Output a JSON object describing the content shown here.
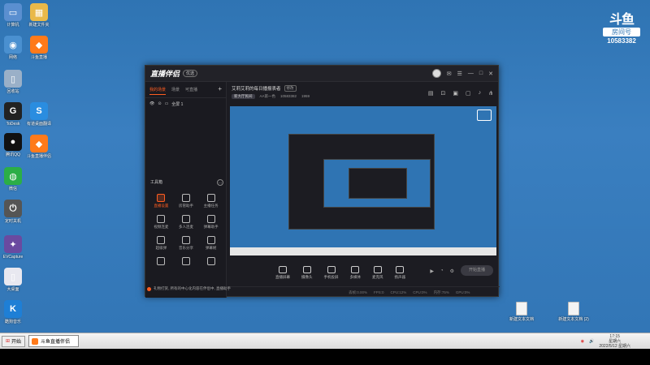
{
  "desktop": {
    "icons_left": [
      {
        "label": "计算机",
        "color": "#5a8fd0",
        "glyph": "▭"
      },
      {
        "label": "网络",
        "color": "#4a90d0",
        "glyph": "◉"
      },
      {
        "label": "回收站",
        "color": "#9ab0c8",
        "glyph": "▯"
      },
      {
        "label": "ToDesk",
        "color": "#222222",
        "glyph": "G"
      },
      {
        "label": "腾讯QQ",
        "color": "#111111",
        "glyph": "●"
      },
      {
        "label": "微信",
        "color": "#2bae47",
        "glyph": "◍"
      },
      {
        "label": "定时关机",
        "color": "#555555",
        "glyph": "⏻"
      },
      {
        "label": "EVCapture",
        "color": "#6a4aa0",
        "glyph": "✦"
      },
      {
        "label": "大桌面",
        "color": "#e8e8f0",
        "glyph": "▯"
      },
      {
        "label": "酷狗音乐",
        "color": "#1e7fd6",
        "glyph": "K"
      }
    ],
    "icons_col2": [
      {
        "label": "新建文件夹",
        "color": "#e9b949",
        "glyph": "▦"
      },
      {
        "label": "斗鱼直播",
        "color": "#ff7a1a",
        "glyph": "◆"
      },
      {
        "label": "有道桌面翻译",
        "color": "#2a8de0",
        "glyph": "S"
      },
      {
        "label": "斗鱼直播伴侣",
        "color": "#ff7a1a",
        "glyph": "◆"
      }
    ],
    "files_right": [
      {
        "label": "新建文本文档"
      },
      {
        "label": "新建文本文档 (2)"
      }
    ],
    "logo": {
      "mark": "斗鱼",
      "room_label": "房间号",
      "room_number": "10583382"
    }
  },
  "app": {
    "title": "直播伴侣",
    "version_badge": "优选",
    "titlebar_icons": [
      "avatar-icon",
      "message-icon",
      "menu-icon",
      "minimize-icon",
      "maximize-icon",
      "close-icon"
    ],
    "sidebar": {
      "tabs": [
        "我的场景",
        "场景",
        "可直播"
      ],
      "plus": "+",
      "scene_label": "全屏 1",
      "tools_title": "工具箱",
      "tools": [
        {
          "label": "直播设置",
          "hot": true
        },
        {
          "label": "房管助手",
          "hot": false
        },
        {
          "label": "主播任务",
          "hot": false
        },
        {
          "label": "视频连麦",
          "hot": false
        },
        {
          "label": "多人连麦",
          "hot": false
        },
        {
          "label": "弹幕助手",
          "hot": false
        },
        {
          "label": "超级弹",
          "hot": false
        },
        {
          "label": "音乐分享",
          "hot": false
        },
        {
          "label": "弹幕姬",
          "hot": false
        },
        {
          "label": "",
          "hot": false
        },
        {
          "label": "",
          "hot": false
        },
        {
          "label": "",
          "hot": false
        }
      ],
      "notice": "礼物打赏, 所有的中心化内容在伴侣中, 直播助手"
    },
    "main": {
      "room_title": "艾莉艾莉的每日播报表者",
      "edit_label": "修改",
      "category": "新大厅民间",
      "room_label": "AA第一色",
      "room_id": "10583382",
      "fans": "1959",
      "bottom_tools": [
        {
          "label": "直播屏幕"
        },
        {
          "label": "摄像头"
        },
        {
          "label": "手机投屏"
        },
        {
          "label": "多媒体"
        },
        {
          "label": "麦克风"
        },
        {
          "label": "扬声器"
        }
      ],
      "go_live": "开始直播",
      "status_items": [
        "丢帧:0.00%",
        "FPS:0",
        "CPU:12%",
        "CPU:0%",
        "内存:75%",
        "GPU:0%"
      ]
    }
  },
  "taskbar": {
    "start": "开始",
    "task_label": "斗鱼直播伴侣",
    "time": "17:15",
    "weekday": "星期六",
    "date": "2022/5/12 星期六"
  }
}
